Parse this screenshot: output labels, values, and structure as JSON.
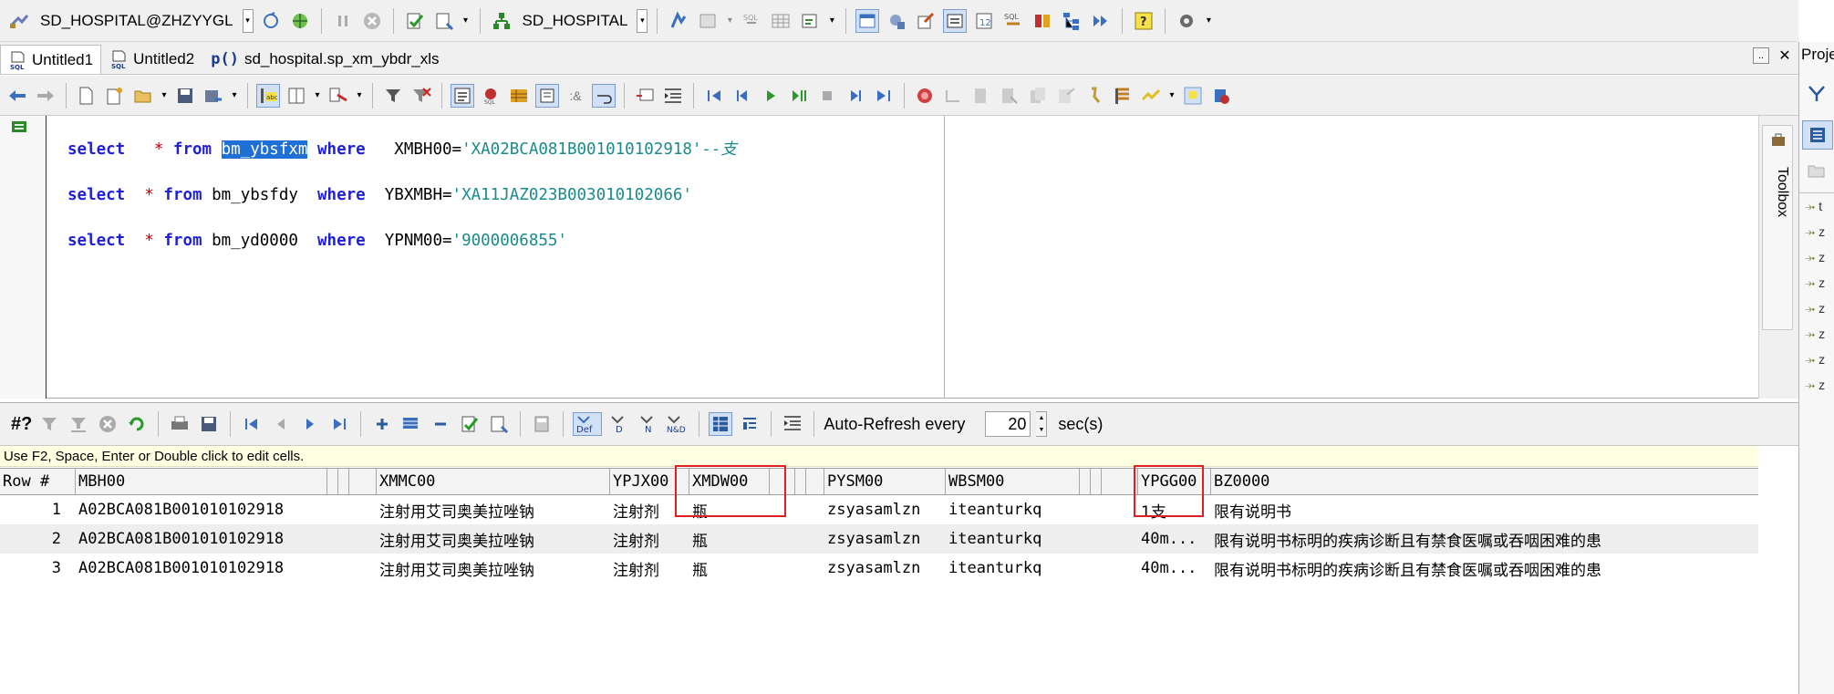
{
  "toolbar1": {
    "connection": "SD_HOSPITAL@ZHZYYGL",
    "schema": "SD_HOSPITAL"
  },
  "tabs": [
    {
      "label": "Untitled1",
      "active": true
    },
    {
      "label": "Untitled2",
      "active": false
    },
    {
      "prefix": "p()",
      "label": "sd_hospital.sp_xm_ybdr_xls",
      "active": false
    }
  ],
  "tabs_controls": {
    "dots": "..",
    "close": "✕"
  },
  "editor": {
    "lines": [
      {
        "kw1": "select",
        "star": "*",
        "kw2": "from",
        "table": "bm_ybsfxm",
        "table_selected": true,
        "kw3": "where",
        "col": "XMBH00=",
        "value": "'XA02BCA081B001010102918'",
        "comment": "--支"
      },
      {
        "kw1": "select",
        "star": "*",
        "kw2": "from",
        "table": "bm_ybsfdy",
        "table_selected": false,
        "kw3": "where",
        "col": "YBXMBH=",
        "value": "'XA11JAZ023B003010102066'",
        "comment": ""
      },
      {
        "kw1": "select",
        "star": "*",
        "kw2": "from",
        "table": "bm_yd0000",
        "table_selected": false,
        "kw3": "where",
        "col": "YPNM00=",
        "value": "'9000006855'",
        "comment": ""
      }
    ]
  },
  "toolbox": {
    "label": "Toolbox"
  },
  "right_panel": {
    "title": "Proje",
    "items": [
      "t",
      "z",
      "z",
      "z",
      "z",
      "z",
      "z",
      "z"
    ]
  },
  "result_toolbar": {
    "hash": "#?",
    "auto_refresh_label": "Auto-Refresh every",
    "refresh_seconds": "20",
    "unit": "sec(s)"
  },
  "hint": "Use F2, Space, Enter or Double click to edit cells.",
  "grid": {
    "headers": [
      "Row #",
      "MBH00",
      "XMMC00",
      "YPJX00",
      "XMDW00",
      "PYSM00",
      "WBSM00",
      "YPGG00",
      "BZ0000"
    ],
    "rows": [
      {
        "num": "1",
        "xmbh": "A02BCA081B001010102918",
        "xmmc": "注射用艾司奥美拉唑钠",
        "ypjx": "注射剂",
        "xmdw": "瓶",
        "pysm": "zsyasamlzn",
        "wbsm": "iteanturkq",
        "ypgg": "1支",
        "bz": "限有说明书"
      },
      {
        "num": "2",
        "xmbh": "A02BCA081B001010102918",
        "xmmc": "注射用艾司奥美拉唑钠",
        "ypjx": "注射剂",
        "xmdw": "瓶",
        "pysm": "zsyasamlzn",
        "wbsm": "iteanturkq",
        "ypgg": "40m...",
        "bz": "限有说明书标明的疾病诊断且有禁食医嘱或吞咽困难的患"
      },
      {
        "num": "3",
        "xmbh": "A02BCA081B001010102918",
        "xmmc": "注射用艾司奥美拉唑钠",
        "ypjx": "注射剂",
        "xmdw": "瓶",
        "pysm": "zsyasamlzn",
        "wbsm": "iteanturkq",
        "ypgg": "40m...",
        "bz": "限有说明书标明的疾病诊断且有禁食医嘱或吞咽困难的患"
      }
    ]
  },
  "colors": {
    "highlight_box": "#e02020",
    "keyword": "#1f1fd6",
    "string": "#1a8a8a",
    "selection": "#1e6fd6"
  }
}
